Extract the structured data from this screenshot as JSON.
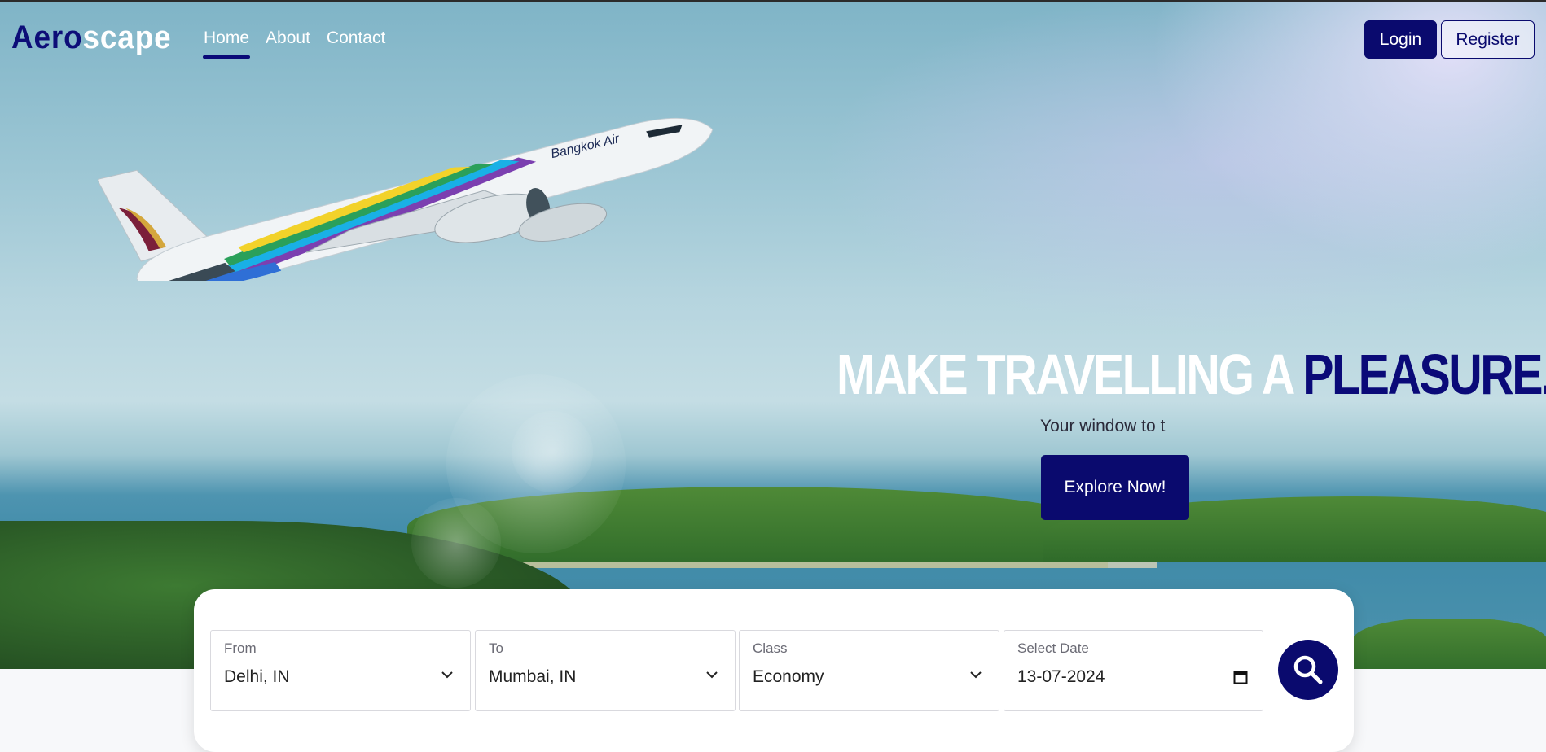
{
  "brand": {
    "part1": "Aero",
    "part2": "scape"
  },
  "nav": {
    "items": [
      {
        "label": "Home",
        "active": true
      },
      {
        "label": "About",
        "active": false
      },
      {
        "label": "Contact",
        "active": false
      }
    ]
  },
  "auth": {
    "login_label": "Login",
    "register_label": "Register"
  },
  "hero": {
    "headline_white": "MAKE TRAVELLING A ",
    "headline_blue": "PLEASURE.",
    "subtitle": "Your window to t",
    "cta_label": "Explore Now!",
    "plane_livery": "Bangkok Air"
  },
  "search": {
    "from": {
      "label": "From",
      "value": "Delhi, IN"
    },
    "to": {
      "label": "To",
      "value": "Mumbai, IN"
    },
    "class": {
      "label": "Class",
      "value": "Economy"
    },
    "date": {
      "label": "Select Date",
      "value": "13-07-2024"
    },
    "button_icon": "search-icon"
  },
  "colors": {
    "brand_navy": "#0a0a6e",
    "white": "#ffffff"
  }
}
